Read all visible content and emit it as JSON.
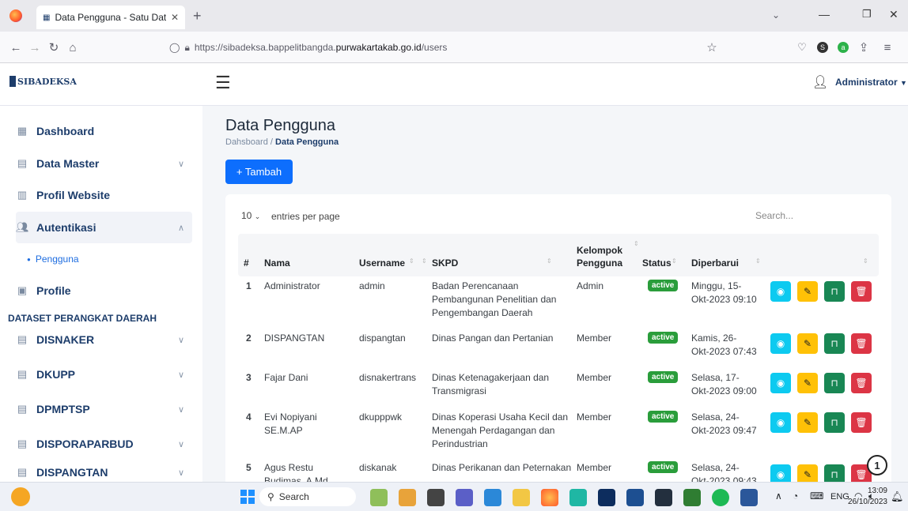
{
  "browser": {
    "tab_title": "Data Pengguna - Satu Data Pur",
    "url_prefix": "https://sibadeksa.bappelitbangda.",
    "url_domain": "purwakartakab.go.id",
    "url_path": "/users"
  },
  "header": {
    "logo_text": "SIBADEKSA",
    "user_name": "Administrator"
  },
  "sidebar": {
    "items": [
      {
        "label": "Dashboard",
        "icon": "grid-icon"
      },
      {
        "label": "Data Master",
        "icon": "database-icon"
      },
      {
        "label": "Profil Website",
        "icon": "building-icon"
      },
      {
        "label": "Autentikasi",
        "icon": "users-icon"
      },
      {
        "label": "Pengguna"
      },
      {
        "label": "Profile",
        "icon": "id-card-icon"
      }
    ],
    "section_title": "DATASET PERANGKAT DAERAH",
    "datasets": [
      "DISNAKER",
      "DKUPP",
      "DPMPTSP",
      "DISPORAPARBUD",
      "DISPANGTAN"
    ]
  },
  "page": {
    "title": "Data Pengguna",
    "breadcrumb_home": "Dahsboard",
    "breadcrumb_sep": "/",
    "breadcrumb_current": "Data Pengguna",
    "add_button": "+ Tambah"
  },
  "table": {
    "per_page": "10",
    "per_page_label": "entries per page",
    "search_placeholder": "Search...",
    "headers": {
      "num": "#",
      "nama": "Nama",
      "username": "Username",
      "skpd": "SKPD",
      "kelompok_1": "Kelompok",
      "kelompok_2": "Pengguna",
      "status": "Status",
      "diperbarui": "Diperbarui"
    },
    "rows": [
      {
        "no": "1",
        "nama": "Administrator",
        "nama2": "",
        "username": "admin",
        "skpd": [
          "Badan Perencanaan",
          "Pembangunan Penelitian dan",
          "Pengembangan Daerah"
        ],
        "kelompok": "Admin",
        "status": "active",
        "date1": "Minggu, 15-",
        "date2": "Okt-2023 09:10"
      },
      {
        "no": "2",
        "nama": "DISPANGTAN",
        "nama2": "",
        "username": "dispangtan",
        "skpd": [
          "Dinas Pangan dan Pertanian",
          "",
          ""
        ],
        "kelompok": "Member",
        "status": "active",
        "date1": "Kamis, 26-",
        "date2": "Okt-2023 07:43"
      },
      {
        "no": "3",
        "nama": "Fajar Dani",
        "nama2": "",
        "username": "disnakertrans",
        "skpd": [
          "Dinas Ketenagakerjaan dan",
          "Transmigrasi",
          ""
        ],
        "kelompok": "Member",
        "status": "active",
        "date1": "Selasa, 17-",
        "date2": "Okt-2023 09:00"
      },
      {
        "no": "4",
        "nama": "Evi Nopiyani",
        "nama2": "SE.M.AP",
        "username": "dkupppwk",
        "skpd": [
          "Dinas Koperasi Usaha Kecil dan",
          "Menengah Perdagangan dan",
          "Perindustrian"
        ],
        "kelompok": "Member",
        "status": "active",
        "date1": "Selasa, 24-",
        "date2": "Okt-2023 09:47"
      },
      {
        "no": "5",
        "nama": "Agus Restu",
        "nama2": "Budimas, A.Md",
        "username": "diskanak",
        "skpd": [
          "Dinas Perikanan dan Peternakan",
          "",
          ""
        ],
        "kelompok": "Member",
        "status": "active",
        "date1": "Selasa, 24-",
        "date2": "Okt-2023 09:43"
      }
    ]
  },
  "notification_badge": "1",
  "taskbar": {
    "search": "Search",
    "lang": "ENG",
    "time": "13:09",
    "date": "26/10/2023"
  },
  "colors": {
    "primary": "#0d6efd",
    "view": "#0dcaf0",
    "edit": "#ffc107",
    "lock": "#198754",
    "delete": "#dc3545",
    "status_active": "#2a9d3b",
    "sidebar_text": "#1d3d6b"
  }
}
